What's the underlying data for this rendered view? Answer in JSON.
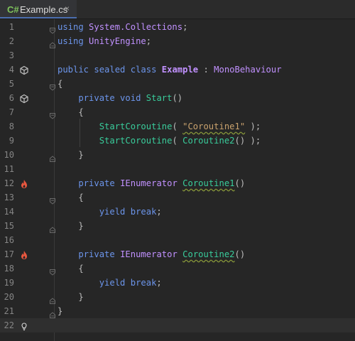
{
  "tab": {
    "lang": "C#",
    "title": "Example.cs",
    "close": "×"
  },
  "lines": [
    {
      "n": "1",
      "tokens": [
        [
          "kw",
          "using"
        ],
        [
          "plain",
          " "
        ],
        [
          "ns",
          "System.Collections"
        ],
        [
          "plain",
          ";"
        ]
      ]
    },
    {
      "n": "2",
      "tokens": [
        [
          "kw",
          "using"
        ],
        [
          "plain",
          " "
        ],
        [
          "ns",
          "UnityEngine"
        ],
        [
          "plain",
          ";"
        ]
      ]
    },
    {
      "n": "3",
      "tokens": []
    },
    {
      "n": "4",
      "tokens": [
        [
          "kw",
          "public sealed class"
        ],
        [
          "plain",
          " "
        ],
        [
          "cls",
          "Example"
        ],
        [
          "plain",
          " : "
        ],
        [
          "type",
          "MonoBehaviour"
        ]
      ]
    },
    {
      "n": "5",
      "tokens": [
        [
          "plain",
          "{"
        ]
      ]
    },
    {
      "n": "6",
      "tokens": [
        [
          "plain",
          "    "
        ],
        [
          "kw",
          "private void"
        ],
        [
          "plain",
          " "
        ],
        [
          "fn",
          "Start"
        ],
        [
          "plain",
          "()"
        ]
      ]
    },
    {
      "n": "7",
      "tokens": [
        [
          "plain",
          "    {"
        ]
      ]
    },
    {
      "n": "8",
      "tokens": [
        [
          "plain",
          "        "
        ],
        [
          "fn",
          "StartCoroutine"
        ],
        [
          "plain",
          "( "
        ],
        [
          "strw",
          "\"Coroutine1\""
        ],
        [
          "plain",
          " );"
        ]
      ]
    },
    {
      "n": "9",
      "tokens": [
        [
          "plain",
          "        "
        ],
        [
          "fn",
          "StartCoroutine"
        ],
        [
          "plain",
          "( "
        ],
        [
          "fn",
          "Coroutine2"
        ],
        [
          "plain",
          "() );"
        ]
      ]
    },
    {
      "n": "10",
      "tokens": [
        [
          "plain",
          "    }"
        ]
      ]
    },
    {
      "n": "11",
      "tokens": []
    },
    {
      "n": "12",
      "tokens": [
        [
          "plain",
          "    "
        ],
        [
          "kw",
          "private"
        ],
        [
          "plain",
          " "
        ],
        [
          "type",
          "IEnumerator"
        ],
        [
          "plain",
          " "
        ],
        [
          "fnw",
          "Coroutine1"
        ],
        [
          "plain",
          "()"
        ]
      ]
    },
    {
      "n": "13",
      "tokens": [
        [
          "plain",
          "    {"
        ]
      ]
    },
    {
      "n": "14",
      "tokens": [
        [
          "plain",
          "        "
        ],
        [
          "kw",
          "yield break"
        ],
        [
          "plain",
          ";"
        ]
      ]
    },
    {
      "n": "15",
      "tokens": [
        [
          "plain",
          "    }"
        ]
      ]
    },
    {
      "n": "16",
      "tokens": []
    },
    {
      "n": "17",
      "tokens": [
        [
          "plain",
          "    "
        ],
        [
          "kw",
          "private"
        ],
        [
          "plain",
          " "
        ],
        [
          "type",
          "IEnumerator"
        ],
        [
          "plain",
          " "
        ],
        [
          "fnw",
          "Coroutine2"
        ],
        [
          "plain",
          "()"
        ]
      ]
    },
    {
      "n": "18",
      "tokens": [
        [
          "plain",
          "    {"
        ]
      ]
    },
    {
      "n": "19",
      "tokens": [
        [
          "plain",
          "        "
        ],
        [
          "kw",
          "yield break"
        ],
        [
          "plain",
          ";"
        ]
      ]
    },
    {
      "n": "20",
      "tokens": [
        [
          "plain",
          "    }"
        ]
      ]
    },
    {
      "n": "21",
      "tokens": [
        [
          "plain",
          "}"
        ]
      ]
    },
    {
      "n": "22",
      "tokens": []
    }
  ],
  "gutter_icons": {
    "4": "unity-icon",
    "6": "unity-icon",
    "12": "coroutine-hot-icon",
    "17": "coroutine-hot-icon",
    "22": "lightbulb-icon"
  },
  "fold_markers": {
    "1": "start",
    "2": "end",
    "5": "start",
    "7": "start",
    "10": "end",
    "13": "start",
    "15": "end",
    "18": "start",
    "20": "end",
    "21": "end"
  },
  "current_line": "22",
  "colors": {
    "background": "#262626",
    "keyword": "#6c95eb",
    "type": "#c191ff",
    "method": "#39cc9b",
    "string": "#c9a26d"
  }
}
